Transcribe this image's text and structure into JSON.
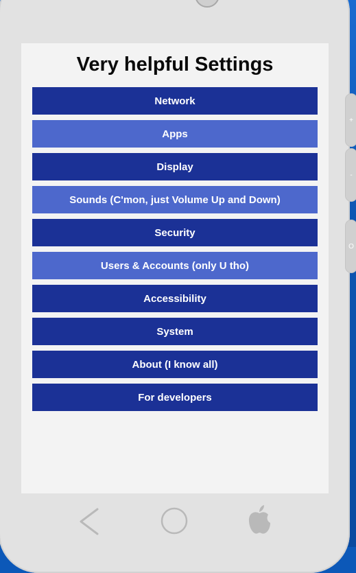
{
  "screen": {
    "title": "Very helpful Settings"
  },
  "menu": {
    "items": [
      {
        "label": "Network",
        "shade": "dark"
      },
      {
        "label": "Apps",
        "shade": "light"
      },
      {
        "label": "Display",
        "shade": "dark"
      },
      {
        "label": "Sounds (C'mon, just Volume Up and Down)",
        "shade": "light"
      },
      {
        "label": "Security",
        "shade": "dark"
      },
      {
        "label": "Users & Accounts (only U tho)",
        "shade": "light"
      },
      {
        "label": "Accessibility",
        "shade": "dark"
      },
      {
        "label": "System",
        "shade": "dark"
      },
      {
        "label": "About (I know all)",
        "shade": "dark"
      },
      {
        "label": "For developers",
        "shade": "dark"
      }
    ]
  },
  "side_buttons": {
    "volume_up": "+",
    "volume_down": "-",
    "power": "O"
  },
  "nav_bar": {
    "back_icon": "back-chevron-icon",
    "home_icon": "home-circle-icon",
    "logo_icon": "apple-logo-icon"
  },
  "colors": {
    "item_dark": "#1b3196",
    "item_light": "#4d68cc",
    "screen_bg": "#f3f3f3",
    "phone_body": "#e2e2e2",
    "desktop_bg": "#0c58b8"
  }
}
